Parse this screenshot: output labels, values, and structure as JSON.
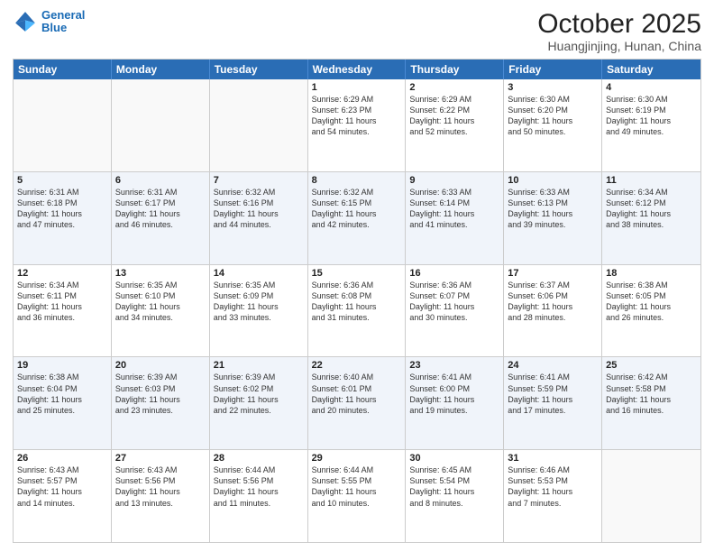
{
  "logo": {
    "line1": "General",
    "line2": "Blue"
  },
  "title": "October 2025",
  "location": "Huangjinjing, Hunan, China",
  "weekdays": [
    "Sunday",
    "Monday",
    "Tuesday",
    "Wednesday",
    "Thursday",
    "Friday",
    "Saturday"
  ],
  "rows": [
    [
      {
        "day": "",
        "info": ""
      },
      {
        "day": "",
        "info": ""
      },
      {
        "day": "",
        "info": ""
      },
      {
        "day": "1",
        "info": "Sunrise: 6:29 AM\nSunset: 6:23 PM\nDaylight: 11 hours\nand 54 minutes."
      },
      {
        "day": "2",
        "info": "Sunrise: 6:29 AM\nSunset: 6:22 PM\nDaylight: 11 hours\nand 52 minutes."
      },
      {
        "day": "3",
        "info": "Sunrise: 6:30 AM\nSunset: 6:20 PM\nDaylight: 11 hours\nand 50 minutes."
      },
      {
        "day": "4",
        "info": "Sunrise: 6:30 AM\nSunset: 6:19 PM\nDaylight: 11 hours\nand 49 minutes."
      }
    ],
    [
      {
        "day": "5",
        "info": "Sunrise: 6:31 AM\nSunset: 6:18 PM\nDaylight: 11 hours\nand 47 minutes."
      },
      {
        "day": "6",
        "info": "Sunrise: 6:31 AM\nSunset: 6:17 PM\nDaylight: 11 hours\nand 46 minutes."
      },
      {
        "day": "7",
        "info": "Sunrise: 6:32 AM\nSunset: 6:16 PM\nDaylight: 11 hours\nand 44 minutes."
      },
      {
        "day": "8",
        "info": "Sunrise: 6:32 AM\nSunset: 6:15 PM\nDaylight: 11 hours\nand 42 minutes."
      },
      {
        "day": "9",
        "info": "Sunrise: 6:33 AM\nSunset: 6:14 PM\nDaylight: 11 hours\nand 41 minutes."
      },
      {
        "day": "10",
        "info": "Sunrise: 6:33 AM\nSunset: 6:13 PM\nDaylight: 11 hours\nand 39 minutes."
      },
      {
        "day": "11",
        "info": "Sunrise: 6:34 AM\nSunset: 6:12 PM\nDaylight: 11 hours\nand 38 minutes."
      }
    ],
    [
      {
        "day": "12",
        "info": "Sunrise: 6:34 AM\nSunset: 6:11 PM\nDaylight: 11 hours\nand 36 minutes."
      },
      {
        "day": "13",
        "info": "Sunrise: 6:35 AM\nSunset: 6:10 PM\nDaylight: 11 hours\nand 34 minutes."
      },
      {
        "day": "14",
        "info": "Sunrise: 6:35 AM\nSunset: 6:09 PM\nDaylight: 11 hours\nand 33 minutes."
      },
      {
        "day": "15",
        "info": "Sunrise: 6:36 AM\nSunset: 6:08 PM\nDaylight: 11 hours\nand 31 minutes."
      },
      {
        "day": "16",
        "info": "Sunrise: 6:36 AM\nSunset: 6:07 PM\nDaylight: 11 hours\nand 30 minutes."
      },
      {
        "day": "17",
        "info": "Sunrise: 6:37 AM\nSunset: 6:06 PM\nDaylight: 11 hours\nand 28 minutes."
      },
      {
        "day": "18",
        "info": "Sunrise: 6:38 AM\nSunset: 6:05 PM\nDaylight: 11 hours\nand 26 minutes."
      }
    ],
    [
      {
        "day": "19",
        "info": "Sunrise: 6:38 AM\nSunset: 6:04 PM\nDaylight: 11 hours\nand 25 minutes."
      },
      {
        "day": "20",
        "info": "Sunrise: 6:39 AM\nSunset: 6:03 PM\nDaylight: 11 hours\nand 23 minutes."
      },
      {
        "day": "21",
        "info": "Sunrise: 6:39 AM\nSunset: 6:02 PM\nDaylight: 11 hours\nand 22 minutes."
      },
      {
        "day": "22",
        "info": "Sunrise: 6:40 AM\nSunset: 6:01 PM\nDaylight: 11 hours\nand 20 minutes."
      },
      {
        "day": "23",
        "info": "Sunrise: 6:41 AM\nSunset: 6:00 PM\nDaylight: 11 hours\nand 19 minutes."
      },
      {
        "day": "24",
        "info": "Sunrise: 6:41 AM\nSunset: 5:59 PM\nDaylight: 11 hours\nand 17 minutes."
      },
      {
        "day": "25",
        "info": "Sunrise: 6:42 AM\nSunset: 5:58 PM\nDaylight: 11 hours\nand 16 minutes."
      }
    ],
    [
      {
        "day": "26",
        "info": "Sunrise: 6:43 AM\nSunset: 5:57 PM\nDaylight: 11 hours\nand 14 minutes."
      },
      {
        "day": "27",
        "info": "Sunrise: 6:43 AM\nSunset: 5:56 PM\nDaylight: 11 hours\nand 13 minutes."
      },
      {
        "day": "28",
        "info": "Sunrise: 6:44 AM\nSunset: 5:56 PM\nDaylight: 11 hours\nand 11 minutes."
      },
      {
        "day": "29",
        "info": "Sunrise: 6:44 AM\nSunset: 5:55 PM\nDaylight: 11 hours\nand 10 minutes."
      },
      {
        "day": "30",
        "info": "Sunrise: 6:45 AM\nSunset: 5:54 PM\nDaylight: 11 hours\nand 8 minutes."
      },
      {
        "day": "31",
        "info": "Sunrise: 6:46 AM\nSunset: 5:53 PM\nDaylight: 11 hours\nand 7 minutes."
      },
      {
        "day": "",
        "info": ""
      }
    ]
  ]
}
